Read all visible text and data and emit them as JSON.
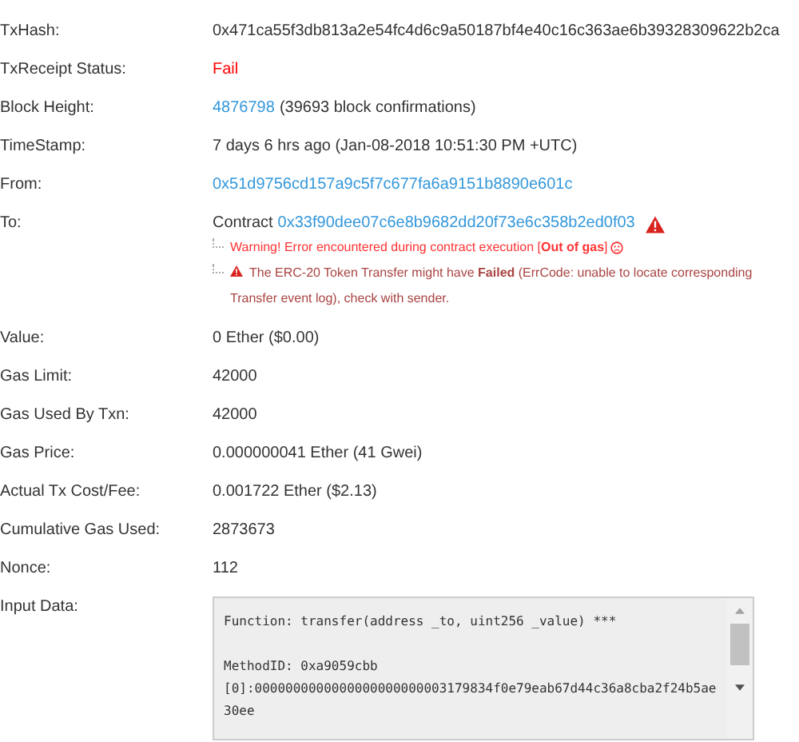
{
  "rows": [
    {
      "label": "TxHash:",
      "value": [
        {
          "kind": "plain",
          "text": "0x471ca55f3db813a2e54fc4d6c9a50187bf4e40c16c363ae6b39328309622b2ca"
        }
      ]
    },
    {
      "label": "TxReceipt Status:",
      "value": [
        {
          "kind": "fail",
          "text": "Fail"
        }
      ]
    },
    {
      "label": "Block Height:",
      "value": [
        {
          "kind": "link",
          "text": "4876798"
        },
        {
          "kind": "plain",
          "text": "(39693 block confirmations)"
        }
      ]
    },
    {
      "label": "TimeStamp:",
      "value": [
        {
          "kind": "plain",
          "text": "7 days 6 hrs ago (Jan-08-2018 10:51:30 PM +UTC)"
        }
      ]
    },
    {
      "label": "From:",
      "value": [
        {
          "kind": "link",
          "text": "0x51d9756cd157a9c5f7c677fa6a9151b8890e601c"
        }
      ]
    },
    {
      "label": "To:",
      "value": [
        {
          "kind": "plain",
          "text": "Contract"
        },
        {
          "kind": "link",
          "text": "0x33f90dee07c6e8b9682dd20f73e6c358b2ed0f03"
        },
        {
          "kind": "alert"
        }
      ],
      "notes": [
        {
          "kind": "error",
          "text": "Warning! Error encountered during contract execution [**Out of gas**]"
        },
        {
          "kind": "token",
          "text": "The ERC-20 Token Transfer might have **Failed** (ErrCode: unable to locate corresponding Transfer event log), check with sender."
        }
      ]
    },
    {
      "label": "Value:",
      "value": [
        {
          "kind": "plain",
          "text": "0 Ether ($0.00)"
        }
      ]
    },
    {
      "label": "Gas Limit:",
      "value": [
        {
          "kind": "plain",
          "text": "42000"
        }
      ]
    },
    {
      "label": "Gas Used By Txn:",
      "value": [
        {
          "kind": "plain",
          "text": "42000"
        }
      ]
    },
    {
      "label": "Gas Price:",
      "value": [
        {
          "kind": "plain",
          "text": "0.000000041 Ether (41 Gwei)"
        }
      ]
    },
    {
      "label": "Actual Tx Cost/Fee:",
      "value": [
        {
          "kind": "plain",
          "text": "0.001722 Ether ($2.13)"
        }
      ]
    },
    {
      "label": "Cumulative Gas Used:",
      "value": [
        {
          "kind": "plain",
          "text": "2873673"
        }
      ]
    },
    {
      "label": "Nonce:",
      "value": [
        {
          "kind": "plain",
          "text": "112"
        }
      ]
    }
  ],
  "input_data": {
    "label": "Input Data:",
    "blocks": [
      [
        "Function: transfer(address _to, uint256 _value) ***"
      ],
      [
        "MethodID: 0xa9059cbb",
        "[0]:0000000000000000000000003179834f0e79eab67d44c36a8cba2f24b5ae30ee"
      ]
    ]
  }
}
